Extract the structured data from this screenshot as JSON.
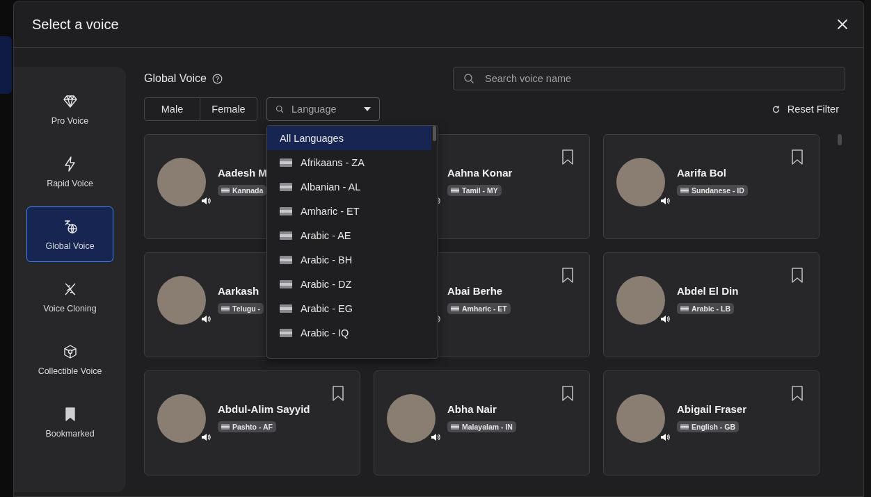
{
  "dialog": {
    "title": "Select a voice"
  },
  "sidebar": {
    "items": [
      {
        "kind": "diamond",
        "label": "Pro Voice",
        "selected": false
      },
      {
        "kind": "bolt",
        "label": "Rapid Voice",
        "selected": false
      },
      {
        "kind": "globe",
        "label": "Global Voice",
        "selected": true
      },
      {
        "kind": "dna",
        "label": "Voice Cloning",
        "selected": false
      },
      {
        "kind": "cube",
        "label": "Collectible Voice",
        "selected": false
      },
      {
        "kind": "bookmark",
        "label": "Bookmarked",
        "selected": false
      }
    ]
  },
  "section_title": "Global Voice",
  "search": {
    "placeholder": "Search voice name"
  },
  "gender_filters": [
    {
      "label": "Male",
      "selected": false
    },
    {
      "label": "Female",
      "selected": false
    }
  ],
  "language_filter": {
    "placeholder": "Language",
    "expanded": true,
    "options": [
      {
        "label": "All Languages",
        "selected": true
      },
      {
        "label": "Afrikaans - ZA",
        "selected": false
      },
      {
        "label": "Albanian - AL",
        "selected": false
      },
      {
        "label": "Amharic - ET",
        "selected": false
      },
      {
        "label": "Arabic - AE",
        "selected": false
      },
      {
        "label": "Arabic - BH",
        "selected": false
      },
      {
        "label": "Arabic - DZ",
        "selected": false
      },
      {
        "label": "Arabic - EG",
        "selected": false
      },
      {
        "label": "Arabic - IQ",
        "selected": false
      }
    ]
  },
  "reset_filter": "Reset Filter",
  "voices": [
    {
      "name": "Aadesh M",
      "language": "Kannada"
    },
    {
      "name": "Aahna Konar",
      "language": "Tamil - MY"
    },
    {
      "name": "Aarifa Bol",
      "language": "Sundanese - ID"
    },
    {
      "name": "Aarkash",
      "language": "Telugu -"
    },
    {
      "name": "Abai Berhe",
      "language": "Amharic - ET"
    },
    {
      "name": "Abdel El Din",
      "language": "Arabic - LB"
    },
    {
      "name": "Abdul-Alim Sayyid",
      "language": "Pashto - AF"
    },
    {
      "name": "Abha Nair",
      "language": "Malayalam - IN"
    },
    {
      "name": "Abigail Fraser",
      "language": "English - GB"
    }
  ]
}
